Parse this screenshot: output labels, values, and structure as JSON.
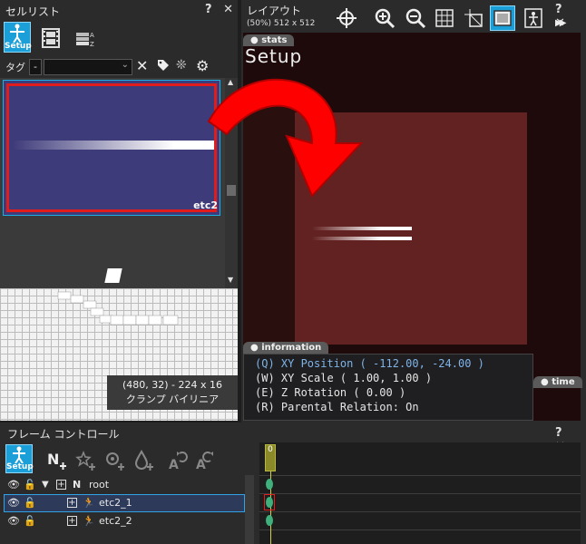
{
  "cell_list": {
    "title": "セルリスト",
    "window_buttons": "? ✕",
    "setup_label": "Setup",
    "tag_label": "タグ",
    "tag_minus": "-",
    "thumb_label": "etc2",
    "tooltip_line1": "(480, 32) - 224 x 16",
    "tooltip_line2": "クランプ バイリニア"
  },
  "layout": {
    "title": "レイアウト",
    "zoom_info": "(50%) 512 x 512",
    "window_buttons": "? ✕",
    "mode_label": "Setup",
    "stats_tab": "stats",
    "information_tab": "information",
    "time_tab": "time",
    "info_lines": [
      "(Q) XY Position ( -112.00, -24.00 )",
      "(W) XY Scale ( 1.00, 1.00 )",
      "(E) Z Rotation ( 0.00 )",
      "(R) Parental Relation: On"
    ]
  },
  "frame_control": {
    "title": "フレーム コントロール",
    "window_buttons": "? ✕",
    "setup_label": "Setup",
    "frame_marker": "0",
    "rows": [
      {
        "label": "root"
      },
      {
        "label": "etc2_1"
      },
      {
        "label": "etc2_2"
      }
    ]
  },
  "colors": {
    "accent": "#1ab0e6",
    "thumb_bg": "#3e3b7a",
    "red": "#e21b1b",
    "canvas_red": "#632222"
  }
}
